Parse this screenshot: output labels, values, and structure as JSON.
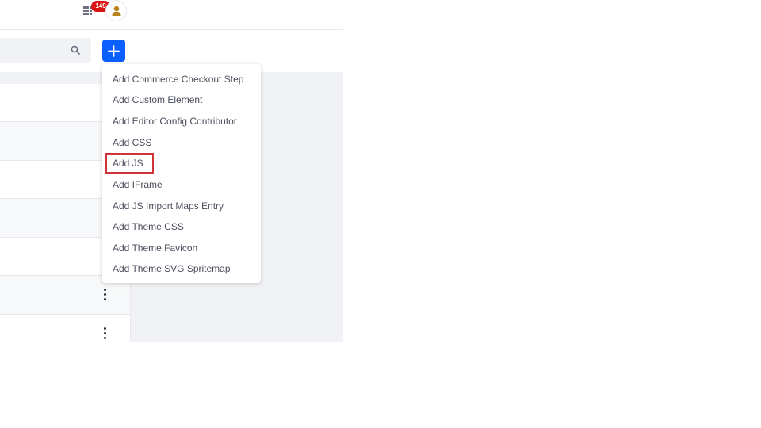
{
  "header": {
    "notifications_count": "149",
    "apps_icon": "apps-grid-icon",
    "avatar_icon": "user-icon"
  },
  "toolbar": {
    "search_value": "",
    "search_icon": "search-icon",
    "add_icon": "plus-icon"
  },
  "dropdown": {
    "items": [
      {
        "label": "Add Commerce Checkout Step"
      },
      {
        "label": "Add Custom Element"
      },
      {
        "label": "Add Editor Config Contributor"
      },
      {
        "label": "Add CSS"
      },
      {
        "label": "Add JS"
      },
      {
        "label": "Add IFrame"
      },
      {
        "label": "Add JS Import Maps Entry"
      },
      {
        "label": "Add Theme CSS"
      },
      {
        "label": "Add Theme Favicon"
      },
      {
        "label": "Add Theme SVG Spritemap"
      }
    ],
    "highlighted_item": "Add JS"
  },
  "colors": {
    "accent": "#0b5fff",
    "badge": "#da1414",
    "highlight": "#d13438",
    "panel": "#f1f2f5"
  }
}
